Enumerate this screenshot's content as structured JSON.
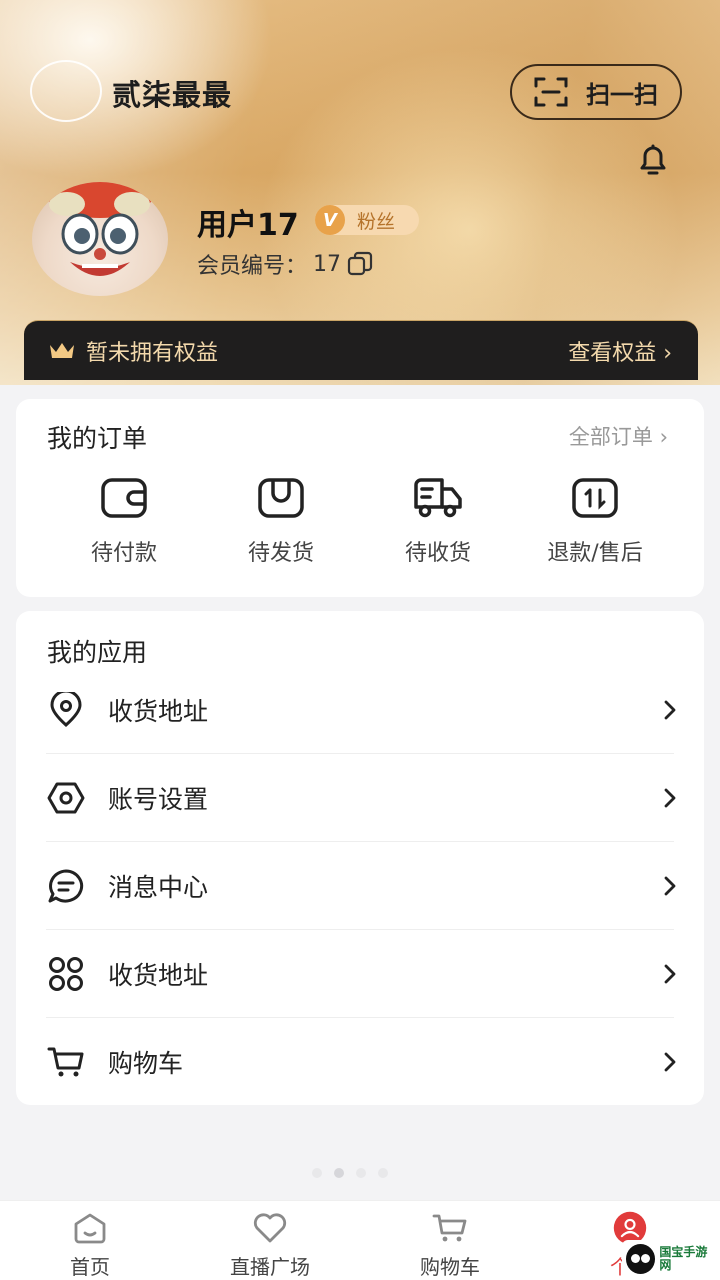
{
  "header": {
    "brand_name": "贰柒最最",
    "scan_label": "扫一扫",
    "username": "用户17",
    "badge_icon_letter": "V",
    "badge_label": "粉丝",
    "member_no_label": "会员编号：",
    "member_no_value": "17",
    "benefit_text": "暂未拥有权益",
    "benefit_link": "查看权益 ›"
  },
  "orders": {
    "title": "我的订单",
    "all_label": "全部订单 ›",
    "items": [
      {
        "label": "待付款",
        "icon": "wallet-icon"
      },
      {
        "label": "待发货",
        "icon": "package-icon"
      },
      {
        "label": "待收货",
        "icon": "truck-icon"
      },
      {
        "label": "退款/售后",
        "icon": "refund-icon"
      }
    ]
  },
  "apps": {
    "title": "我的应用",
    "items": [
      {
        "label": "收货地址",
        "icon": "location-pin-icon"
      },
      {
        "label": "账号设置",
        "icon": "settings-hexagon-icon"
      },
      {
        "label": "消息中心",
        "icon": "message-bubble-icon"
      },
      {
        "label": "收货地址",
        "icon": "grid-apps-icon"
      },
      {
        "label": "购物车",
        "icon": "cart-icon"
      }
    ]
  },
  "tabbar": {
    "items": [
      {
        "label": "首页",
        "icon": "home-icon"
      },
      {
        "label": "直播广场",
        "icon": "heart-icon"
      },
      {
        "label": "购物车",
        "icon": "cart-icon"
      },
      {
        "label": "个人",
        "icon": "user-icon"
      }
    ],
    "active_index": 3
  },
  "watermark": {
    "text": "国宝手游网"
  },
  "colors": {
    "accent": "#e13b3b",
    "benefit_bar": "#1f1e1e",
    "benefit_text": "#f3d9ac",
    "badge_bg": "#f7d9b0"
  }
}
